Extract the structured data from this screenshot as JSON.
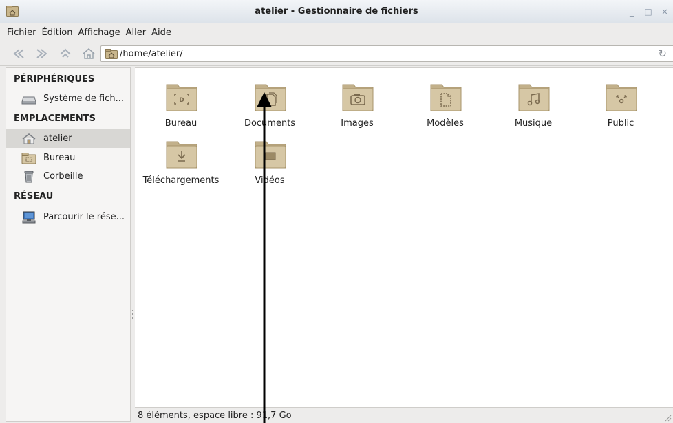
{
  "window": {
    "title": "atelier - Gestionnaire de fichiers",
    "controls": {
      "minimize": "_",
      "maximize": "□",
      "close": "×"
    }
  },
  "menu": {
    "items": [
      {
        "label": "Fichier",
        "mnemonic": "F"
      },
      {
        "label": "Édition",
        "mnemonic": "d"
      },
      {
        "label": "Affichage",
        "mnemonic": "A"
      },
      {
        "label": "Aller",
        "mnemonic": "l"
      },
      {
        "label": "Aide",
        "mnemonic": "e"
      }
    ]
  },
  "toolbar": {
    "icons": [
      "back-icon",
      "forward-icon",
      "up-icon",
      "home-icon"
    ],
    "location": "/home/atelier/",
    "reload_glyph": "↻"
  },
  "sidebar": {
    "headings": {
      "devices": "PÉRIPHÉRIQUES",
      "places": "EMPLACEMENTS",
      "network": "RÉSEAU"
    },
    "devices": [
      {
        "label": "Système de fich...",
        "icon": "drive-icon"
      }
    ],
    "places": [
      {
        "label": "atelier",
        "icon": "home-icon",
        "selected": true
      },
      {
        "label": "Bureau",
        "icon": "desktop-folder-icon",
        "selected": false
      },
      {
        "label": "Corbeille",
        "icon": "trash-icon",
        "selected": false
      }
    ],
    "network": [
      {
        "label": "Parcourir le rése...",
        "icon": "network-icon"
      }
    ]
  },
  "files": [
    {
      "name": "Bureau",
      "icon": "desktop-folder-icon"
    },
    {
      "name": "Documents",
      "icon": "documents-folder-icon"
    },
    {
      "name": "Images",
      "icon": "pictures-folder-icon"
    },
    {
      "name": "Modèles",
      "icon": "templates-folder-icon"
    },
    {
      "name": "Musique",
      "icon": "music-folder-icon"
    },
    {
      "name": "Public",
      "icon": "public-folder-icon"
    },
    {
      "name": "Téléchargements",
      "icon": "downloads-folder-icon"
    },
    {
      "name": "Vidéos",
      "icon": "videos-folder-icon"
    }
  ],
  "status": {
    "text": "8 éléments, espace libre : 91,7 Go"
  },
  "colors": {
    "folder_body": "#d6c7a5",
    "folder_tab": "#c2b08a",
    "folder_glyph": "#7a6a4f",
    "selection": "#d8d7d4",
    "annotation_arrow": "#000000"
  }
}
